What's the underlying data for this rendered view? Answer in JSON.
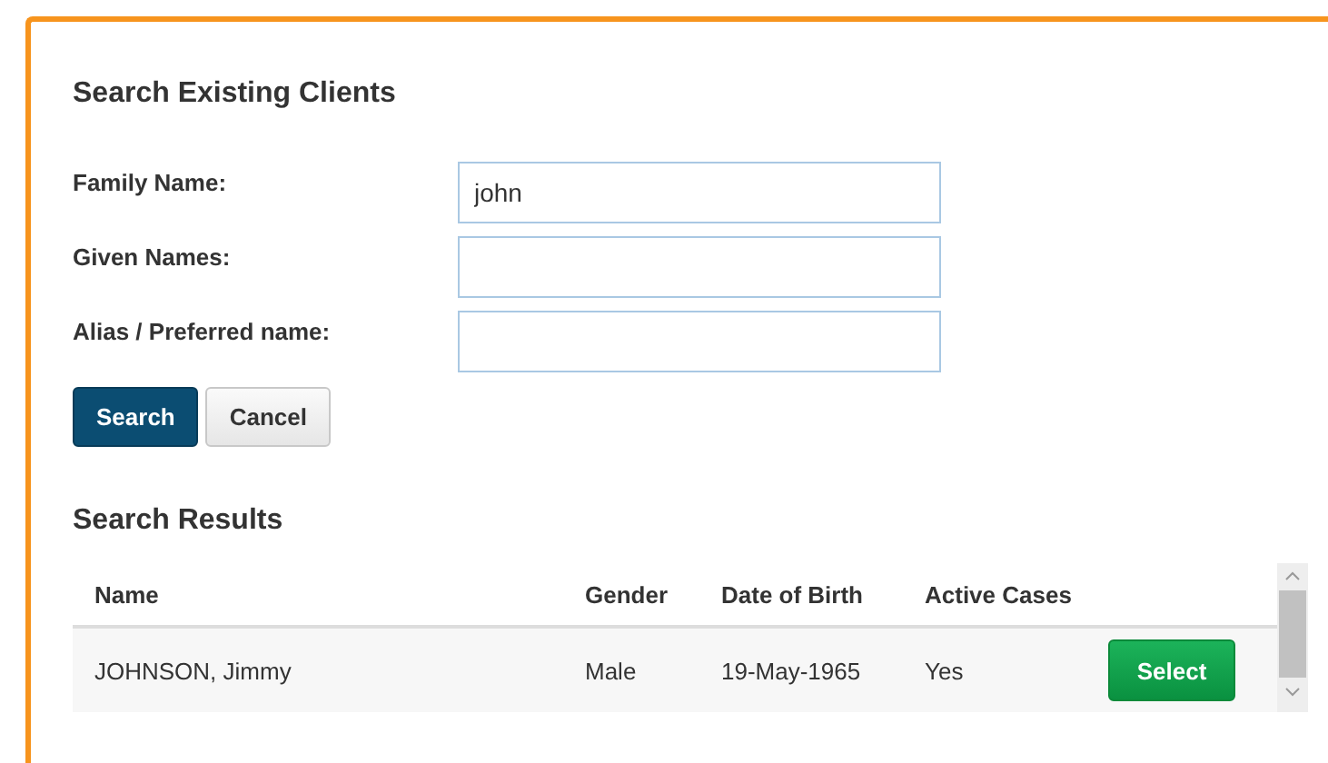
{
  "dialog": {
    "title": "Search Existing Clients"
  },
  "fields": [
    {
      "label": "Family Name:",
      "value": "john"
    },
    {
      "label": "Given Names:"
    },
    {
      "label": "Alias / Preferred name:"
    }
  ],
  "buttons": [
    {
      "label": "Search",
      "kind": "primary"
    },
    {
      "label": "Cancel",
      "kind": "secondary"
    }
  ],
  "results": {
    "title": "Search Results",
    "columns": [
      "Name",
      "Gender",
      "Date of Birth",
      "Active Cases"
    ],
    "rows": [
      {
        "cells": [
          "JOHNSON, Jimmy",
          "Male",
          "19-May-1965",
          "Yes"
        ],
        "action": "Select"
      }
    ]
  }
}
